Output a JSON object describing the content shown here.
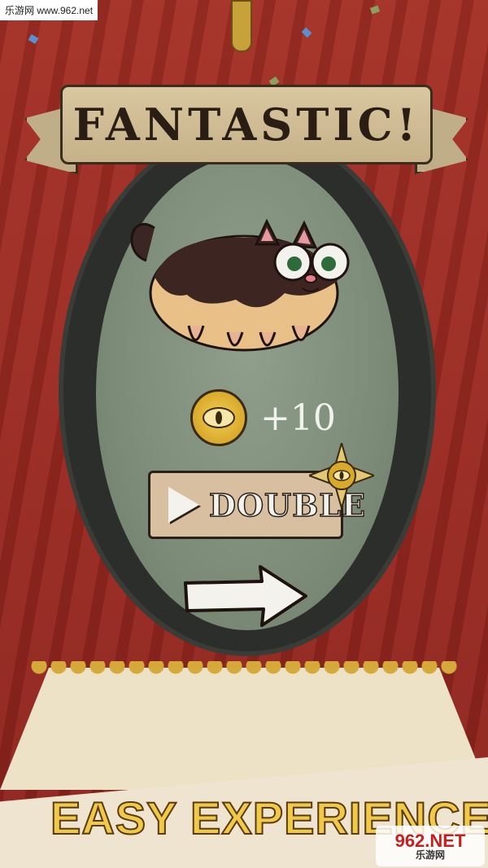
{
  "watermark_top": "乐游网 www.962.net",
  "banner": {
    "title": "FANTASTIC!"
  },
  "reward": {
    "amount": "+10"
  },
  "double_button": {
    "label": "DOUBLE"
  },
  "caption": "EASY EXPERIENCE",
  "watermark_bottom": {
    "main": "962.NET",
    "sub": "乐游网"
  },
  "colors": {
    "curtain": "#9b2a22",
    "mirror": "#7c8c78",
    "coin": "#d9a92a",
    "caption": "#f1c94a"
  },
  "icons": [
    "coin-eye-icon",
    "play-icon",
    "sun-coin-badge-icon",
    "next-arrow-icon",
    "cat-character"
  ]
}
